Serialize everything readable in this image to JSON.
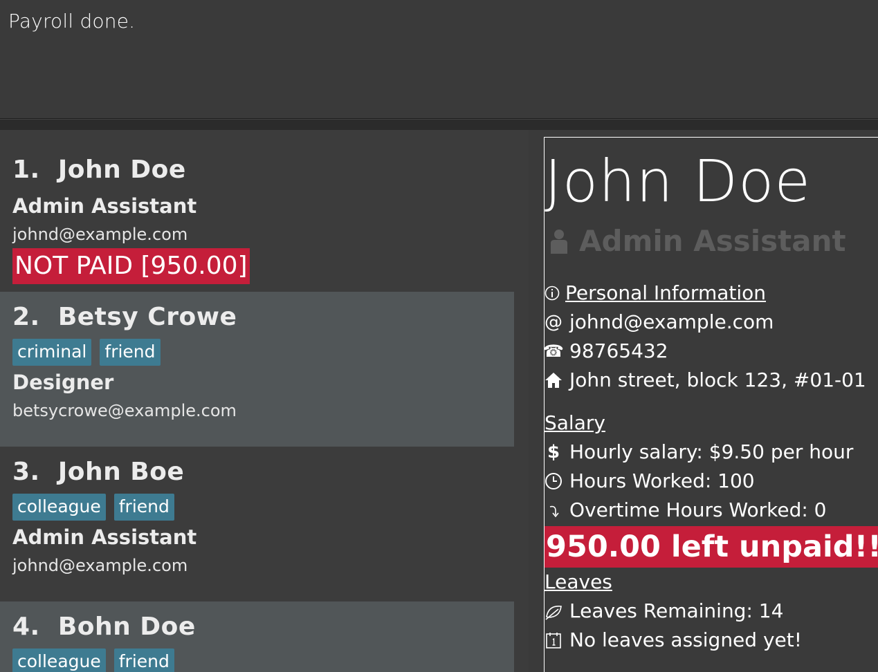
{
  "result": {
    "message": "Payroll done."
  },
  "persons": [
    {
      "index": "1.",
      "name": "John Doe",
      "tags": [],
      "role": "Admin Assistant",
      "email": "johnd@example.com",
      "status": "NOT PAID [950.00]"
    },
    {
      "index": "2.",
      "name": "Betsy Crowe",
      "tags": [
        "criminal",
        "friend"
      ],
      "role": "Designer",
      "email": "betsycrowe@example.com",
      "status": ""
    },
    {
      "index": "3.",
      "name": "John Boe",
      "tags": [
        "colleague",
        "friend"
      ],
      "role": "Admin Assistant",
      "email": "johnd@example.com",
      "status": ""
    },
    {
      "index": "4.",
      "name": "Bohn Doe",
      "tags": [
        "colleague",
        "friend"
      ],
      "role": "",
      "email": "",
      "status": ""
    }
  ],
  "detail": {
    "name": "John Doe",
    "role": "Admin Assistant",
    "personal_header": "Personal Information",
    "email": "johnd@example.com",
    "phone": "98765432",
    "address": "John street, block 123, #01-01",
    "salary_header": "Salary",
    "hourly": "Hourly salary: $9.50 per hour",
    "hours": "Hours Worked: 100",
    "overtime": "Overtime Hours Worked: 0",
    "unpaid": "950.00 left unpaid!!",
    "leaves_header": "Leaves",
    "leaves_remaining": "Leaves Remaining: 14",
    "leaves_assigned": "No leaves assigned yet!"
  },
  "icons": {
    "role": "person-icon",
    "info": "info-icon",
    "email": "at-icon",
    "phone": "phone-icon",
    "address": "home-icon",
    "dollar": "dollar-icon",
    "clock": "clock-icon",
    "overtime": "arrow-icon",
    "leaf": "leaf-icon",
    "calendar": "calendar-icon"
  },
  "colors": {
    "unpaid": "#c51e3a",
    "tag": "#3e7b91",
    "card_alt": "#515658",
    "card": "#3c3c3c"
  }
}
